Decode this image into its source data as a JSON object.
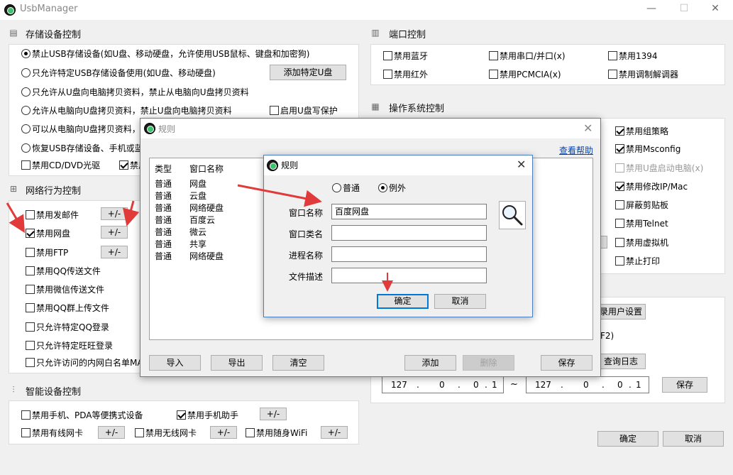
{
  "app": {
    "title": "UsbManager",
    "minimize": "—",
    "maximize": "☐",
    "close": "✕"
  },
  "storage": {
    "title": "存储设备控制",
    "options": [
      "禁止USB存储设备(如U盘、移动硬盘，允许使用USB鼠标、键盘和加密狗)",
      "只允许特定USB存储设备使用(如U盘、移动硬盘)",
      "只允许从U盘向电脑拷贝资料，禁止从电脑向U盘拷贝资料",
      "允许从电脑向U盘拷贝资料，禁止U盘向电脑拷贝资料",
      "可以从电脑向U盘拷贝资料，",
      "恢复USB存储设备、手机或蓝"
    ],
    "add_usb_button": "添加特定U盘",
    "write_protect": "启用U盘写保护",
    "cd_dvd": "禁用CD/DVD光驱",
    "cd_dvd_partial": "禁用"
  },
  "network": {
    "title": "网络行为控制",
    "items": [
      "禁用发邮件",
      "禁用网盘",
      "禁用FTP",
      "禁用QQ传送文件",
      "禁用微信传送文件",
      "禁用QQ群上传文件",
      "只允许特定QQ登录",
      "只允许特定旺旺登录",
      "只允许访问的内网白名单MA"
    ],
    "plusminus": "+/-"
  },
  "smart": {
    "title": "智能设备控制",
    "phone_pda": "禁用手机、PDA等便携式设备",
    "phone_assistant": "禁用手机助手",
    "wired_nic": "禁用有线网卡",
    "wireless_nic": "禁用无线网卡",
    "portable_wifi": "禁用随身WiFi",
    "plusminus": "+/-"
  },
  "ports": {
    "title": "端口控制",
    "items": [
      "禁用蓝牙",
      "禁用串口/并口(x)",
      "禁用1394",
      "禁用红外",
      "禁用PCMCIA(x)",
      "禁用调制解调器"
    ]
  },
  "os": {
    "title": "操作系统控制",
    "items": [
      "禁用组策略",
      "禁用Msconfig",
      "禁用U盘启动电脑(x)",
      "禁用修改IP/Mac",
      "屏蔽剪贴板",
      "禁用Telnet",
      "禁用虚拟机",
      "禁止打印"
    ]
  },
  "misc": {
    "user_settings_partial": "录用户设置",
    "f2_partial": "F2)",
    "query_log_partial": "查询日志",
    "ip_start": [
      "127",
      ".",
      "0",
      ".",
      "0",
      ".",
      "1"
    ],
    "tilde": "~",
    "ip_end": [
      "127",
      ".",
      "0",
      ".",
      "0",
      ".",
      "1"
    ],
    "save": "保存",
    "ok": "确定",
    "cancel": "取消"
  },
  "rules_dialog": {
    "title": "规则",
    "help_link": "查看帮助",
    "col_type": "类型",
    "col_window": "窗口名称",
    "rows": [
      {
        "type": "普通",
        "name": "网盘"
      },
      {
        "type": "普通",
        "name": "云盘"
      },
      {
        "type": "普通",
        "name": "网络硬盘"
      },
      {
        "type": "普通",
        "name": "百度云"
      },
      {
        "type": "普通",
        "name": "微云"
      },
      {
        "type": "普通",
        "name": "共享"
      },
      {
        "type": "普通",
        "name": "网络硬盘"
      }
    ],
    "import": "导入",
    "export": "导出",
    "clear": "清空",
    "add": "添加",
    "delete": "删除",
    "save": "保存"
  },
  "rule_editor": {
    "title": "规则",
    "mode_normal": "普通",
    "mode_exception": "例外",
    "window_name_label": "窗口名称",
    "window_name_value": "百度网盘",
    "window_class_label": "窗口类名",
    "process_label": "进程名称",
    "file_desc_label": "文件描述",
    "ok": "确定",
    "cancel": "取消"
  },
  "colors": {
    "arrow": "#e03a3a",
    "accent": "#0078d7"
  }
}
